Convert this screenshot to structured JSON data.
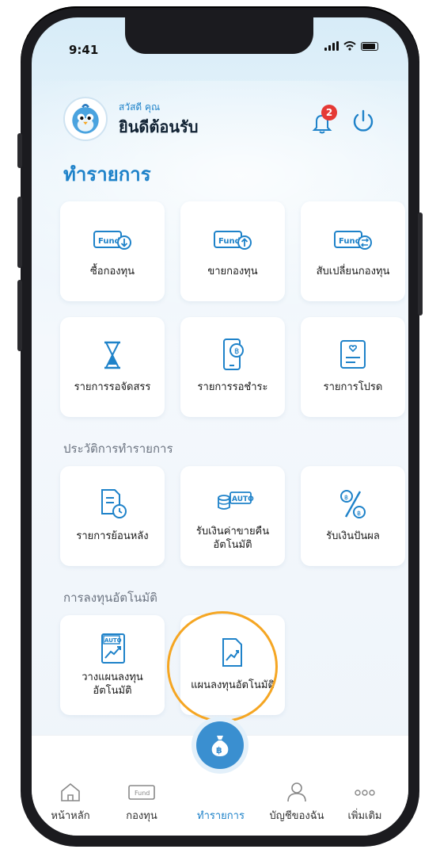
{
  "status_bar": {
    "time": "9:41"
  },
  "header": {
    "greeting_small": "สวัสดี คุณ",
    "greeting_big": "ยินดีต้อนรับ",
    "notification_count": "2"
  },
  "sections": {
    "transactions_title": "ทำรายการ",
    "history_title": "ประวัติการทำรายการ",
    "auto_invest_title": "การลงทุนอัตโนมัติ"
  },
  "transactions": [
    {
      "label": "ซื้อกองทุน",
      "icon": "fund-buy-icon"
    },
    {
      "label": "ขายกองทุน",
      "icon": "fund-sell-icon"
    },
    {
      "label": "สับเปลี่ยนกองทุน",
      "icon": "fund-switch-icon"
    },
    {
      "label": "รายการรอจัดสรร",
      "icon": "hourglass-icon"
    },
    {
      "label": "รายการรอชำระ",
      "icon": "phone-payment-icon"
    },
    {
      "label": "รายการโปรด",
      "icon": "favorite-list-icon"
    }
  ],
  "history": [
    {
      "label": "รายการย้อนหลัง",
      "icon": "document-clock-icon"
    },
    {
      "label_1": "รับเงินค่าขายคืน",
      "label_2": "อัตโนมัติ",
      "icon": "auto-coins-icon",
      "badge": "AUTO"
    },
    {
      "label": "รับเงินปันผล",
      "icon": "dividend-percent-icon"
    }
  ],
  "auto_invest": [
    {
      "label_1": "วางแผนลงทุน",
      "label_2": "อัตโนมัติ",
      "icon": "auto-plan-icon",
      "badge": "AUTO"
    },
    {
      "label": "แผนลงทุนอัตโนมัติ",
      "icon": "plan-chart-icon"
    }
  ],
  "tabbar": {
    "home": "หน้าหลัก",
    "funds": "กองทุน",
    "fund_icon_text": "Fund",
    "transactions": "ทำรายการ",
    "account": "บัญชีของฉัน",
    "more": "เพิ่มเติม"
  },
  "fund_icon_text": "Fund",
  "colors": {
    "accent": "#1e82c9",
    "highlight": "#f5a623",
    "badge": "#e53935"
  }
}
